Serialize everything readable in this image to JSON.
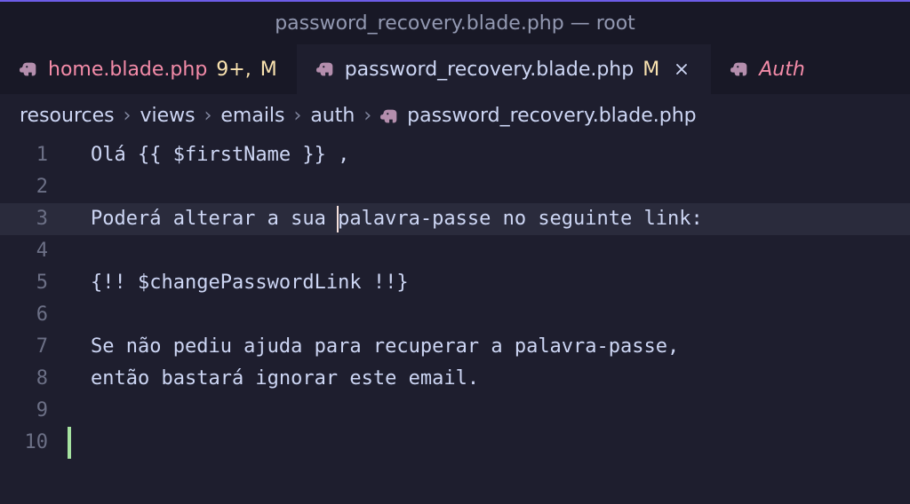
{
  "title": "password_recovery.blade.php — root",
  "tabs": [
    {
      "icon": "elephant-icon",
      "name": "home.blade.php",
      "badge": "9+",
      "status": "M",
      "modified": true
    },
    {
      "icon": "elephant-icon",
      "name": "password_recovery.blade.php",
      "status": "M",
      "active": true
    },
    {
      "icon": "elephant-icon",
      "name": "Auth",
      "truncated": true
    }
  ],
  "breadcrumb": {
    "segments": [
      "resources",
      "views",
      "emails",
      "auth"
    ],
    "file": "password_recovery.blade.php"
  },
  "editor": {
    "cursor_line": 3,
    "cursor_col_ch": 21,
    "lines": [
      {
        "n": 1,
        "text": "Olá {{ $firstName }} ,"
      },
      {
        "n": 2,
        "text": ""
      },
      {
        "n": 3,
        "text": "Poderá alterar a sua palavra-passe no seguinte link:"
      },
      {
        "n": 4,
        "text": ""
      },
      {
        "n": 5,
        "text": "{!! $changePasswordLink !!}"
      },
      {
        "n": 6,
        "text": ""
      },
      {
        "n": 7,
        "text": "Se não pediu ajuda para recuperar a palavra-passe,"
      },
      {
        "n": 8,
        "text": "então bastará ignorar este email."
      },
      {
        "n": 9,
        "text": ""
      },
      {
        "n": 10,
        "text": "",
        "git": "add"
      }
    ]
  },
  "icons": {
    "elephant_label": "elephant-icon",
    "close_label": "close-icon",
    "chevron_label": "chevron-right-icon"
  }
}
